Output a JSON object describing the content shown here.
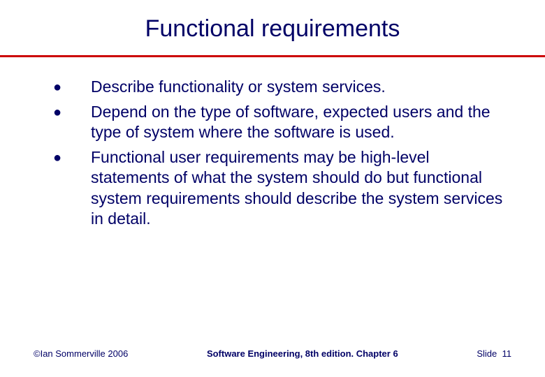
{
  "slide": {
    "title": "Functional requirements",
    "bullets": [
      "Describe functionality or system services.",
      "Depend on the type of software, expected users and the type of system where the software is used.",
      "Functional user requirements may be high-level statements of what the system should do but functional system requirements should describe the system services in detail."
    ],
    "footer": {
      "copyright": "©Ian Sommerville 2006",
      "center": "Software Engineering, 8th edition. Chapter 6",
      "slide_label": "Slide",
      "slide_number": "11"
    }
  }
}
